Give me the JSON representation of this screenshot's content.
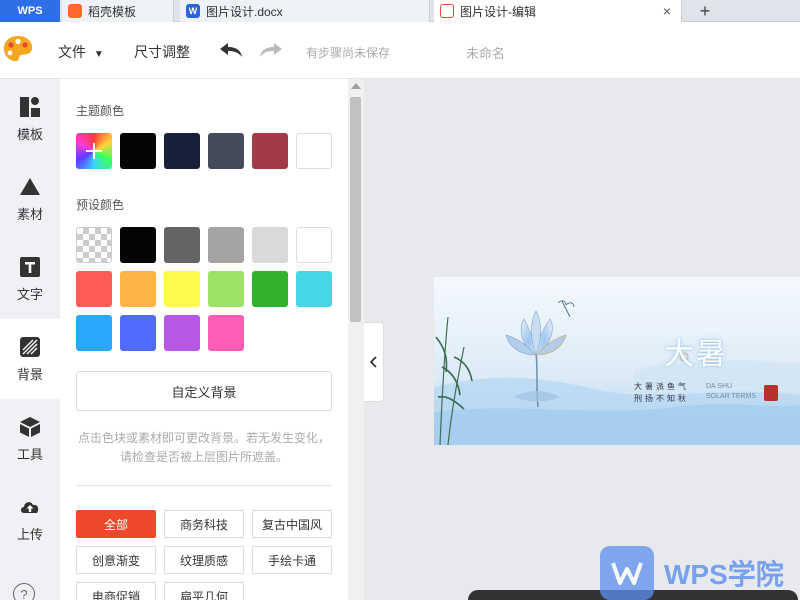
{
  "tabs": {
    "wps": "WPS",
    "templates": "稻壳模板",
    "doc": "图片设计.docx",
    "edit": "图片设计-编辑",
    "close": "×",
    "add": "+"
  },
  "toolbar": {
    "file_menu": "文件",
    "resize": "尺寸调整",
    "save_status": "有步骤尚未保存",
    "doc_name": "未命名"
  },
  "leftnav": {
    "items": [
      {
        "label": "模板",
        "icon": "template-icon"
      },
      {
        "label": "素材",
        "icon": "shapes-icon"
      },
      {
        "label": "文字",
        "icon": "text-icon"
      },
      {
        "label": "背景",
        "icon": "background-icon"
      },
      {
        "label": "工具",
        "icon": "cube-icon"
      },
      {
        "label": "上传",
        "icon": "cloud-upload-icon"
      }
    ],
    "help": "?"
  },
  "panel": {
    "theme_title": "主题颜色",
    "preset_title": "预设颜色",
    "theme_colors": [
      "rainbow-picker",
      "#050505",
      "#17203a",
      "#454b5b",
      "#a43a48",
      "#ffffff"
    ],
    "preset_colors": [
      "transparent",
      "#050505",
      "#646464",
      "#a4a4a4",
      "#d9d9d9",
      "#ffffff",
      "#fd5a58",
      "#feb444",
      "#fefa4b",
      "#9be266",
      "#31b22c",
      "#45d8e4",
      "#2aa8fc",
      "#4f6cfe",
      "#b757e6",
      "#fd5eb3"
    ],
    "custom_bg_button": "自定义背景",
    "hint": "点击色块或素材即可更改背景。若无发生变化，请检查是否被上层图片所遮盖。",
    "categories": [
      "全部",
      "商务科技",
      "复古中国风",
      "创意渐变",
      "纹理质感",
      "手绘卡通",
      "电商促销",
      "扁平几何"
    ]
  },
  "canvas": {
    "title": "大暑",
    "poem_line1": "大暑派鱼气",
    "poem_line2": "刑扬不知秋",
    "english1": "DA SHU",
    "english2": "SOLAR TERMS"
  },
  "watermark": {
    "text": "WPS学院"
  }
}
